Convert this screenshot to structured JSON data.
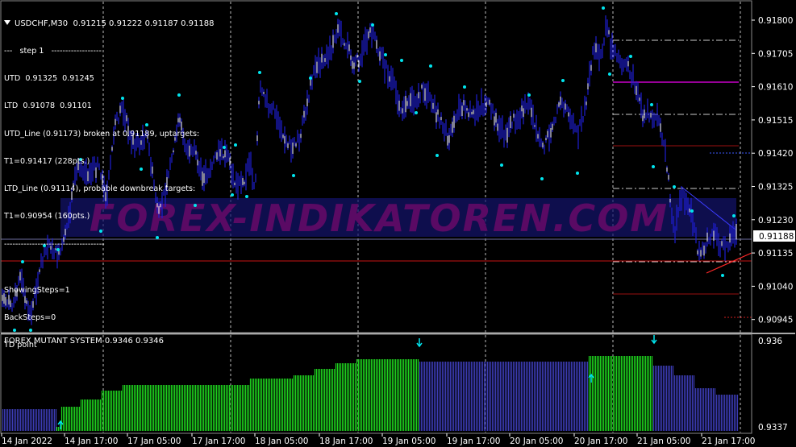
{
  "window": {
    "symbol_timeframe": "USDCHF,M30",
    "ohlc": "0.91215 0.91222 0.91187 0.91188",
    "arrow": "triangle-down-icon"
  },
  "indicator_text": [
    "---   step 1   ------------------",
    "UTD  0.91325  0.91245",
    "LTD  0.91078  0.91101",
    "UTD_Line (0.91173) broken at 0.91189, uptargets:",
    "T1=0.91417 (228pts.)",
    "LTD_Line (0.91114), probable downbreak targets:",
    "T1=0.90954 (160pts.)",
    "------------------------------------",
    "",
    "ShowingSteps=1",
    "BackSteps=0",
    "TD point"
  ],
  "watermark": "FOREX-INDIKATOREN.COM",
  "price_axis": {
    "labels": [
      "0.91800",
      "0.91705",
      "0.91610",
      "0.91515",
      "0.91420",
      "0.91325",
      "0.91230",
      "0.91135",
      "0.91040",
      "0.90945"
    ],
    "current_price": "0.91188",
    "ymin": 0.909,
    "ymax": 0.9194
  },
  "time_axis": {
    "labels": [
      "14 Jan 2022",
      "14 Jan 17:00",
      "17 Jan 05:00",
      "17 Jan 17:00",
      "18 Jan 05:00",
      "18 Jan 17:00",
      "19 Jan 05:00",
      "19 Jan 17:00",
      "20 Jan 05:00",
      "20 Jan 17:00",
      "21 Jan 05:00",
      "21 Jan 17:00"
    ]
  },
  "subwindow": {
    "title": "FOREX MUTANT SYSTEM 0.9346 0.9346",
    "axis_labels": [
      "0.936",
      "0.9337"
    ]
  },
  "colors": {
    "candles": "#1e1ed2",
    "candle_highlight": "#ffffff",
    "td_point": "#00e5ee",
    "magenta_line": "#c800c8",
    "red_line": "#c81414",
    "green_bars": "#1ed21e",
    "blue_bars": "#3c3cb4",
    "watermark": "#5a0a64"
  }
}
